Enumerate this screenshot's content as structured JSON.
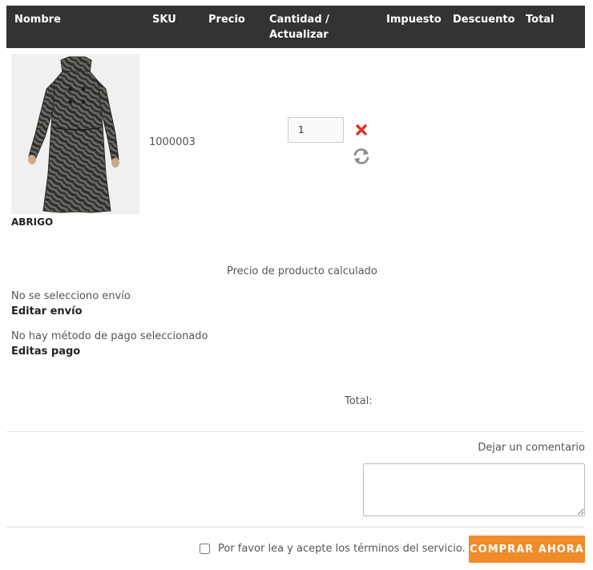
{
  "table_header": {
    "columns": [
      "Nombre",
      "SKU",
      "Precio",
      "Cantidad /",
      "Actualizar",
      "Impuesto",
      "Descuento",
      "Total"
    ]
  },
  "cart_item": {
    "name": "ABRIGO",
    "sku": "1000003",
    "quantity": "1",
    "image_icon": "coat-photo"
  },
  "price_note": "Precio de producto calculado",
  "shipping": {
    "status": "No se selecciono envío",
    "edit_link": "Editar envío"
  },
  "payment": {
    "status": "No hay método de pago seleccionado",
    "edit_link": "Editas pago"
  },
  "totals": {
    "total_label": "Total:"
  },
  "comment": {
    "label": "Dejar un comentario",
    "value": ""
  },
  "checkout": {
    "tos_label": "Por favor lea y acepte los términos del servicio.",
    "tos_checked": false,
    "buy_label": "COMPRAR AHORA"
  },
  "colors": {
    "header_bg": "#333333",
    "accent": "#f08c2a",
    "remove_icon": "#d9352f"
  }
}
